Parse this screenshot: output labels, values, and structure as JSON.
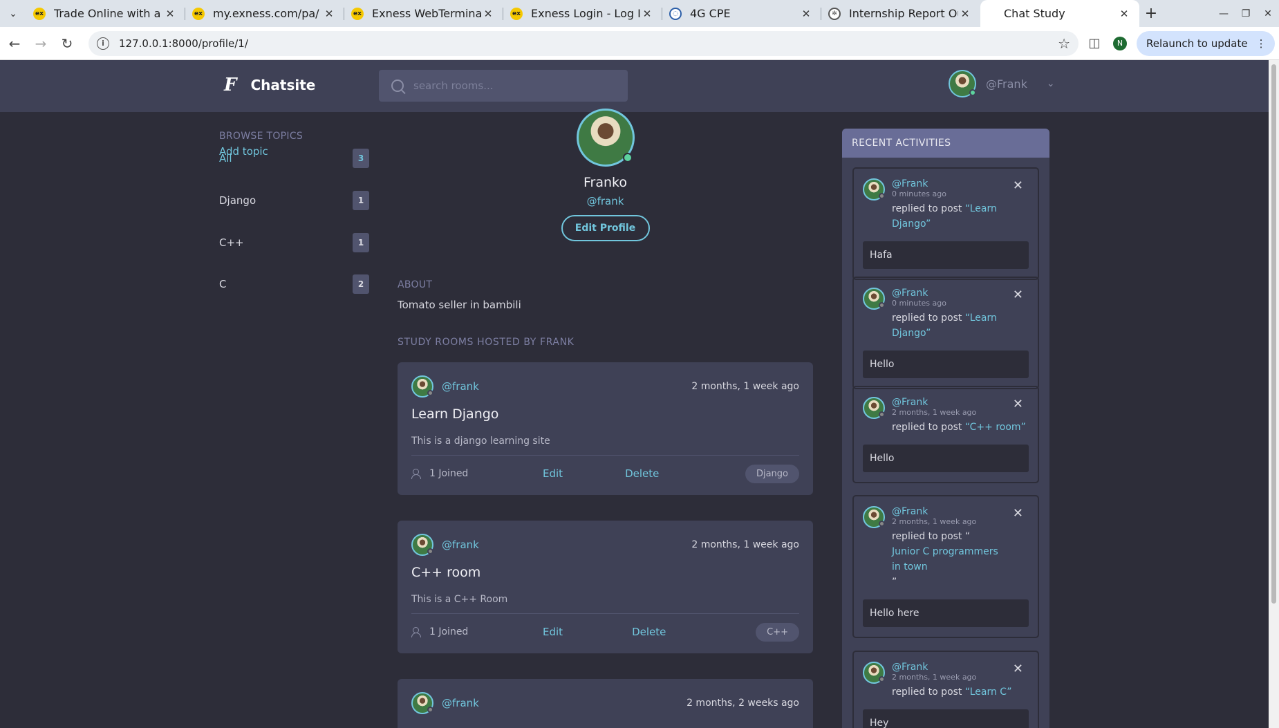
{
  "browser": {
    "tabs": [
      {
        "title": "Trade Online with a Lea",
        "fav": "ex"
      },
      {
        "title": "my.exness.com/pa/",
        "fav": "ex"
      },
      {
        "title": "Exness WebTerminal",
        "fav": "ex"
      },
      {
        "title": "Exness Login - Log In To",
        "fav": "ex"
      },
      {
        "title": "4G CPE",
        "fav": "4g"
      },
      {
        "title": "Internship Report Outli",
        "fav": "gpt"
      },
      {
        "title": "Chat Study",
        "fav": ""
      }
    ],
    "url": "127.0.0.1:8000/profile/1/",
    "relaunch_label": "Relaunch to update",
    "profile_initial": "N"
  },
  "header": {
    "logo_mark": "F",
    "site_name": "Chatsite",
    "search_placeholder": "search rooms...",
    "username": "@Frank"
  },
  "sidebar": {
    "title": "BROWSE TOPICS",
    "add_label": "Add topic",
    "topics": [
      {
        "label": "All",
        "count": "3"
      },
      {
        "label": "Django",
        "count": "1"
      },
      {
        "label": "C++",
        "count": "1"
      },
      {
        "label": "C",
        "count": "2"
      }
    ]
  },
  "profile": {
    "name": "Franko",
    "handle": "@frank",
    "edit_label": "Edit Profile",
    "about_title": "ABOUT",
    "about_text": "Tomato seller in bambili",
    "rooms_title": "STUDY ROOMS HOSTED BY FRANK"
  },
  "rooms": [
    {
      "host": "@frank",
      "when": "2 months, 1 week ago",
      "name": "Learn Django",
      "desc": "This is a django learning site",
      "joined": "1 Joined",
      "edit": "Edit",
      "delete": "Delete",
      "tag": "Django"
    },
    {
      "host": "@frank",
      "when": "2 months, 1 week ago",
      "name": "C++ room",
      "desc": "This is a C++ Room",
      "joined": "1 Joined",
      "edit": "Edit",
      "delete": "Delete",
      "tag": "C++"
    },
    {
      "host": "@frank",
      "when": "2 months, 2 weeks ago",
      "name": "",
      "desc": "",
      "joined": "",
      "edit": "",
      "delete": "",
      "tag": ""
    }
  ],
  "activities": {
    "title": "RECENT ACTIVITIES",
    "items": [
      {
        "user": "@Frank",
        "ago": "0 minutes ago",
        "prefix": "replied to post ",
        "post": "“Learn Django”",
        "body": "Hafa"
      },
      {
        "user": "@Frank",
        "ago": "0 minutes ago",
        "prefix": "replied to post ",
        "post": "“Learn Django”",
        "body": "Hello"
      },
      {
        "user": "@Frank",
        "ago": "2 months, 1 week ago",
        "prefix": "replied to post ",
        "post": "“C++ room”",
        "body": "Hello"
      },
      {
        "user": "@Frank",
        "ago": "2 months, 1 week ago",
        "prefix": "replied to post “",
        "post": "Junior C programmers in town",
        "suffix": "”",
        "body": "Hello here"
      },
      {
        "user": "@Frank",
        "ago": "2 months, 1 week ago",
        "prefix": "replied to post ",
        "post": "“Learn C”",
        "body": "Hey"
      }
    ]
  }
}
